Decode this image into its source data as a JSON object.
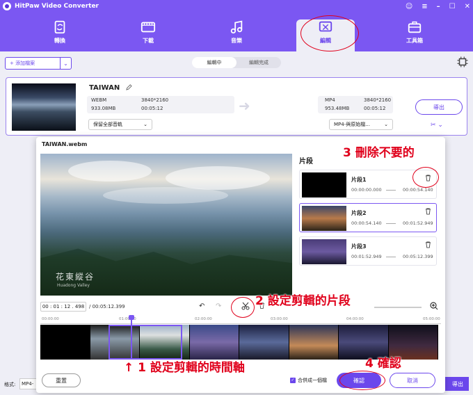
{
  "app": {
    "title": "HitPaw Video Converter"
  },
  "nav": {
    "items": [
      {
        "label": "轉換",
        "icon": "convert-icon"
      },
      {
        "label": "下載",
        "icon": "download-icon"
      },
      {
        "label": "音樂",
        "icon": "music-icon"
      },
      {
        "label": "編輯",
        "icon": "edit-icon",
        "active": true
      },
      {
        "label": "工具箱",
        "icon": "toolbox-icon"
      }
    ]
  },
  "toolbar": {
    "add_file": "+ 添加檔案",
    "tab_editing": "編輯中",
    "tab_done": "編輯完成"
  },
  "file": {
    "name": "TAIWAN",
    "src_format": "WEBM",
    "src_res": "3840*2160",
    "src_size": "933.08MB",
    "src_dur": "00:05:12",
    "dst_format": "MP4",
    "dst_res": "3840*2160",
    "dst_size": "953.48MB",
    "dst_dur": "00:05:12",
    "audio_sel": "保留全部音軌",
    "format_sel": "MP4-與原始檔...",
    "export": "導出"
  },
  "bottom": {
    "format_label": "格式:",
    "format_value": "MP4-",
    "export_all": "導出"
  },
  "modal": {
    "title": "TAIWAN.webm",
    "panel_title": "片段",
    "watermark": "花東縱谷",
    "watermark_sub": "Huadong Valley",
    "segments": [
      {
        "name": "片段1",
        "start": "00:00:00.000",
        "end": "00:00:54.140"
      },
      {
        "name": "片段2",
        "start": "00:00:54.140",
        "end": "00:01:52.949"
      },
      {
        "name": "片段3",
        "start": "00:01:52.949",
        "end": "00:05:12.399"
      }
    ],
    "timecode": "00 : 01 : 12 . 498",
    "total": "/ 00:05:12.399",
    "ruler": [
      "00:00:00",
      "01:00:00",
      "02:00:00",
      "03:00:00",
      "04:00:00",
      "05:00:00"
    ],
    "reset": "重置",
    "merge": "合併成一個檔",
    "confirm": "確認",
    "cancel": "取消"
  },
  "annotations": {
    "a1": "↑  1  設定剪輯的時間軸",
    "a2": "2  設定剪輯的片段",
    "a3": "3  刪除不要的",
    "a4": "4  確認"
  },
  "colors": {
    "accent": "#7b57f2",
    "annotation": "#e0001b"
  }
}
